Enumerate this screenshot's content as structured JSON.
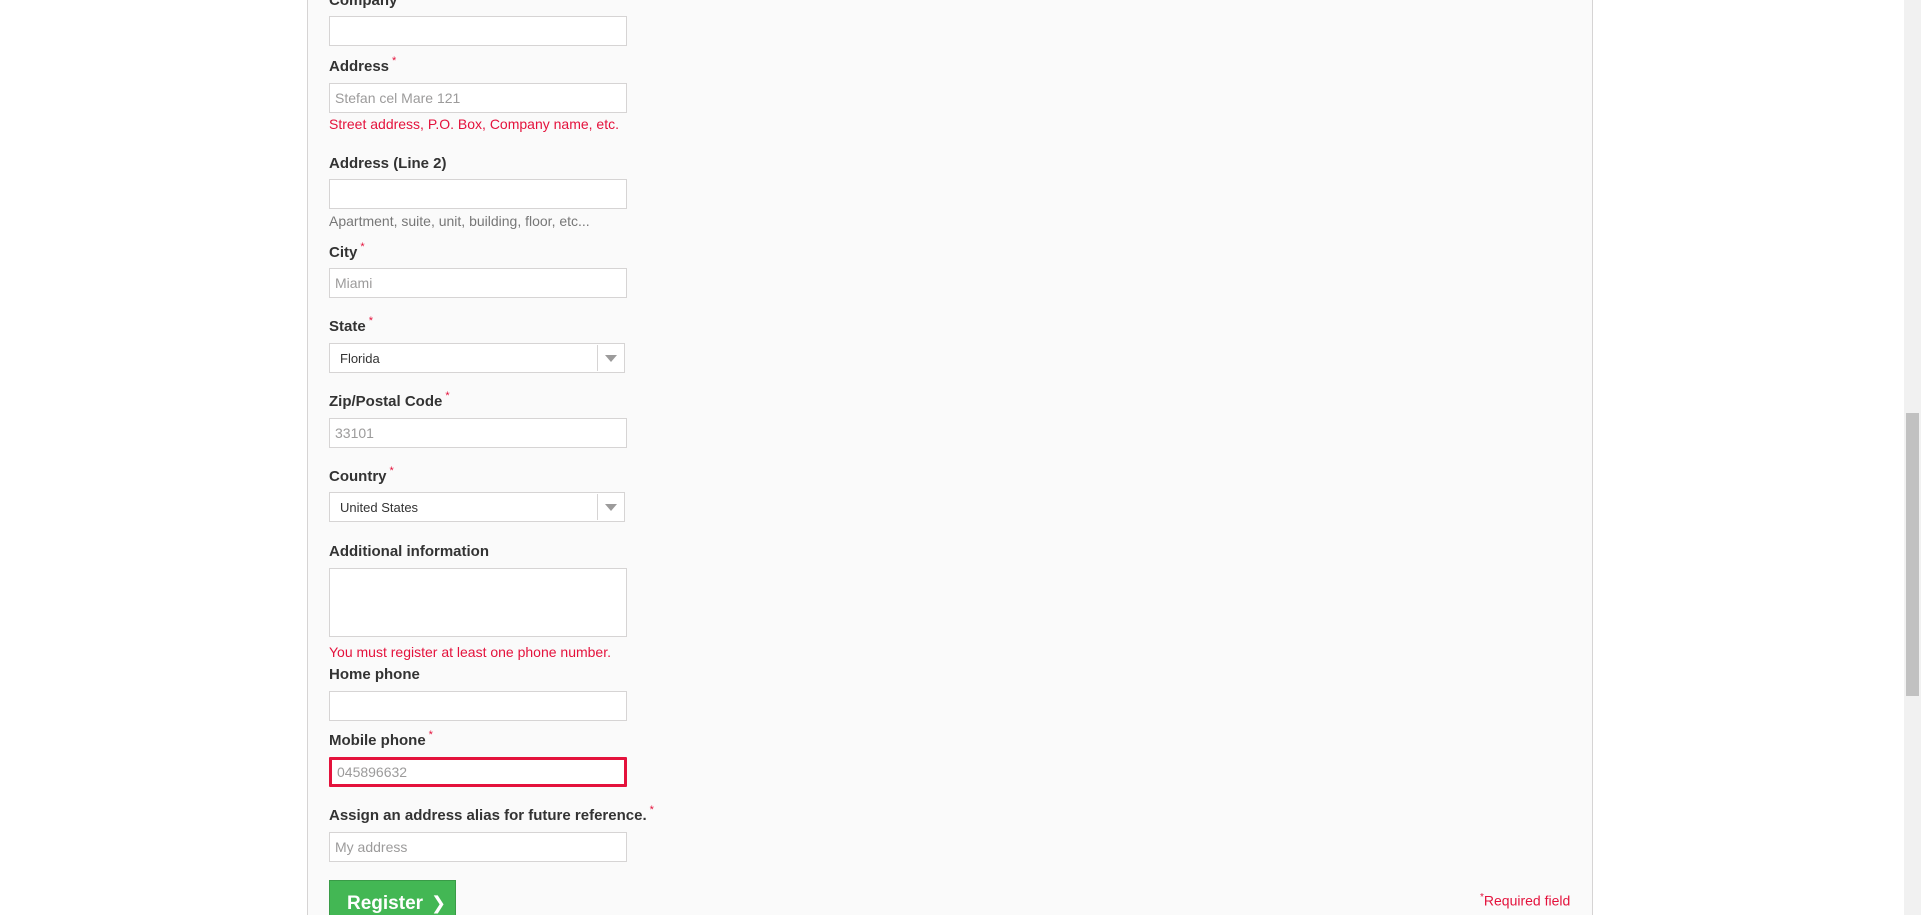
{
  "form": {
    "company": {
      "label": "Company",
      "value": ""
    },
    "address": {
      "label": "Address",
      "required_mark": "*",
      "placeholder": "Stefan cel Mare 121",
      "hint": "Street address, P.O. Box, Company name, etc."
    },
    "address2": {
      "label": "Address (Line 2)",
      "value": "",
      "hint": "Apartment, suite, unit, building, floor, etc..."
    },
    "city": {
      "label": "City",
      "required_mark": "*",
      "placeholder": "Miami"
    },
    "state": {
      "label": "State",
      "required_mark": "*",
      "selected": "Florida"
    },
    "zip": {
      "label": "Zip/Postal Code",
      "required_mark": "*",
      "placeholder": "33101"
    },
    "country": {
      "label": "Country",
      "required_mark": "*",
      "selected": "United States"
    },
    "additional_info": {
      "label": "Additional information",
      "value": ""
    },
    "phone_notice": "You must register at least one phone number.",
    "home_phone": {
      "label": "Home phone",
      "value": ""
    },
    "mobile_phone": {
      "label": "Mobile phone",
      "required_mark": "*",
      "value": "045896632"
    },
    "alias": {
      "label": "Assign an address alias for future reference.",
      "required_mark": "*",
      "placeholder": "My address"
    },
    "register_label": "Register",
    "required_note_mark": "*",
    "required_note": "Required field"
  },
  "colors": {
    "accent_green": "#43b754",
    "error_red": "#e4123c",
    "panel_bg": "#fafafa"
  }
}
